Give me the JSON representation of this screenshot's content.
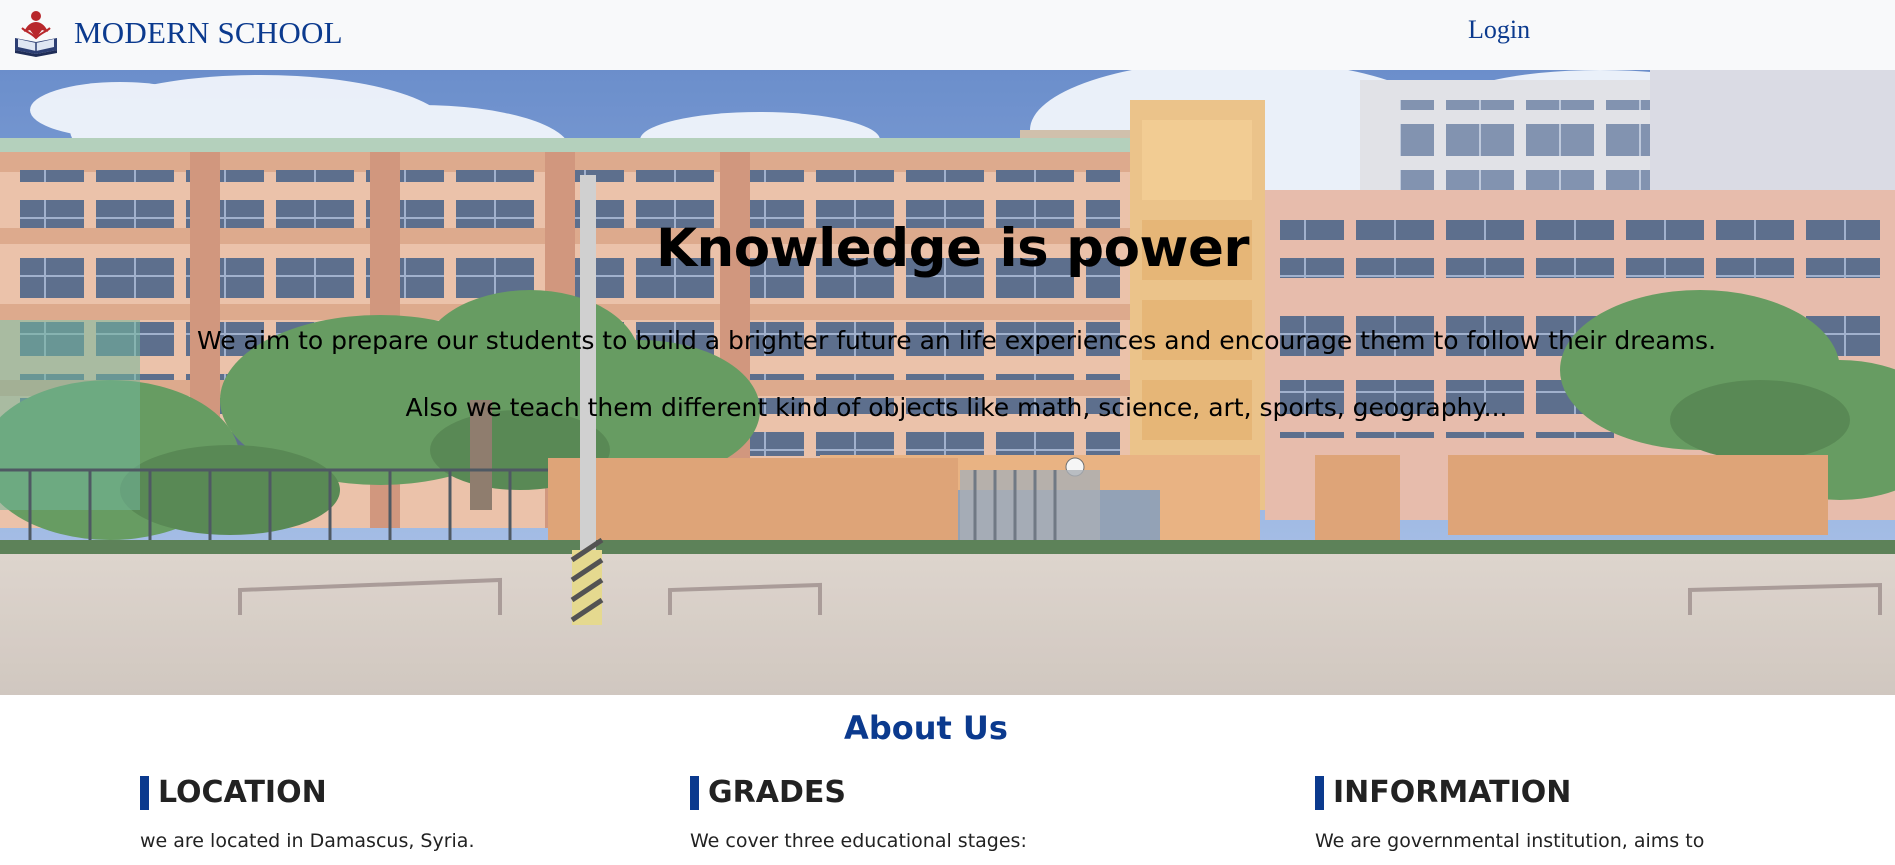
{
  "navbar": {
    "brand_name": "MODERN SCHOOL",
    "login_label": "Login"
  },
  "hero": {
    "title": "Knowledge is power",
    "paragraph_1": "We aim to prepare our students to build a brighter future an life experiences and encourage them to follow their dreams.",
    "paragraph_2": "Also we teach them different kind of objects like math, science, art, sports, geography..."
  },
  "about": {
    "title": "About Us",
    "columns": [
      {
        "heading": "LOCATION",
        "text": "we are located in Damascus, Syria."
      },
      {
        "heading": "GRADES",
        "text": "We cover three educational stages:"
      },
      {
        "heading": "INFORMATION",
        "text": "We are governmental institution, aims to"
      }
    ]
  },
  "colors": {
    "brand_blue": "#0b3a8e",
    "navbar_bg": "#f8f9fa",
    "logo_red": "#b8282c"
  },
  "icons": {
    "brand_logo": "school-book-logo-icon"
  }
}
